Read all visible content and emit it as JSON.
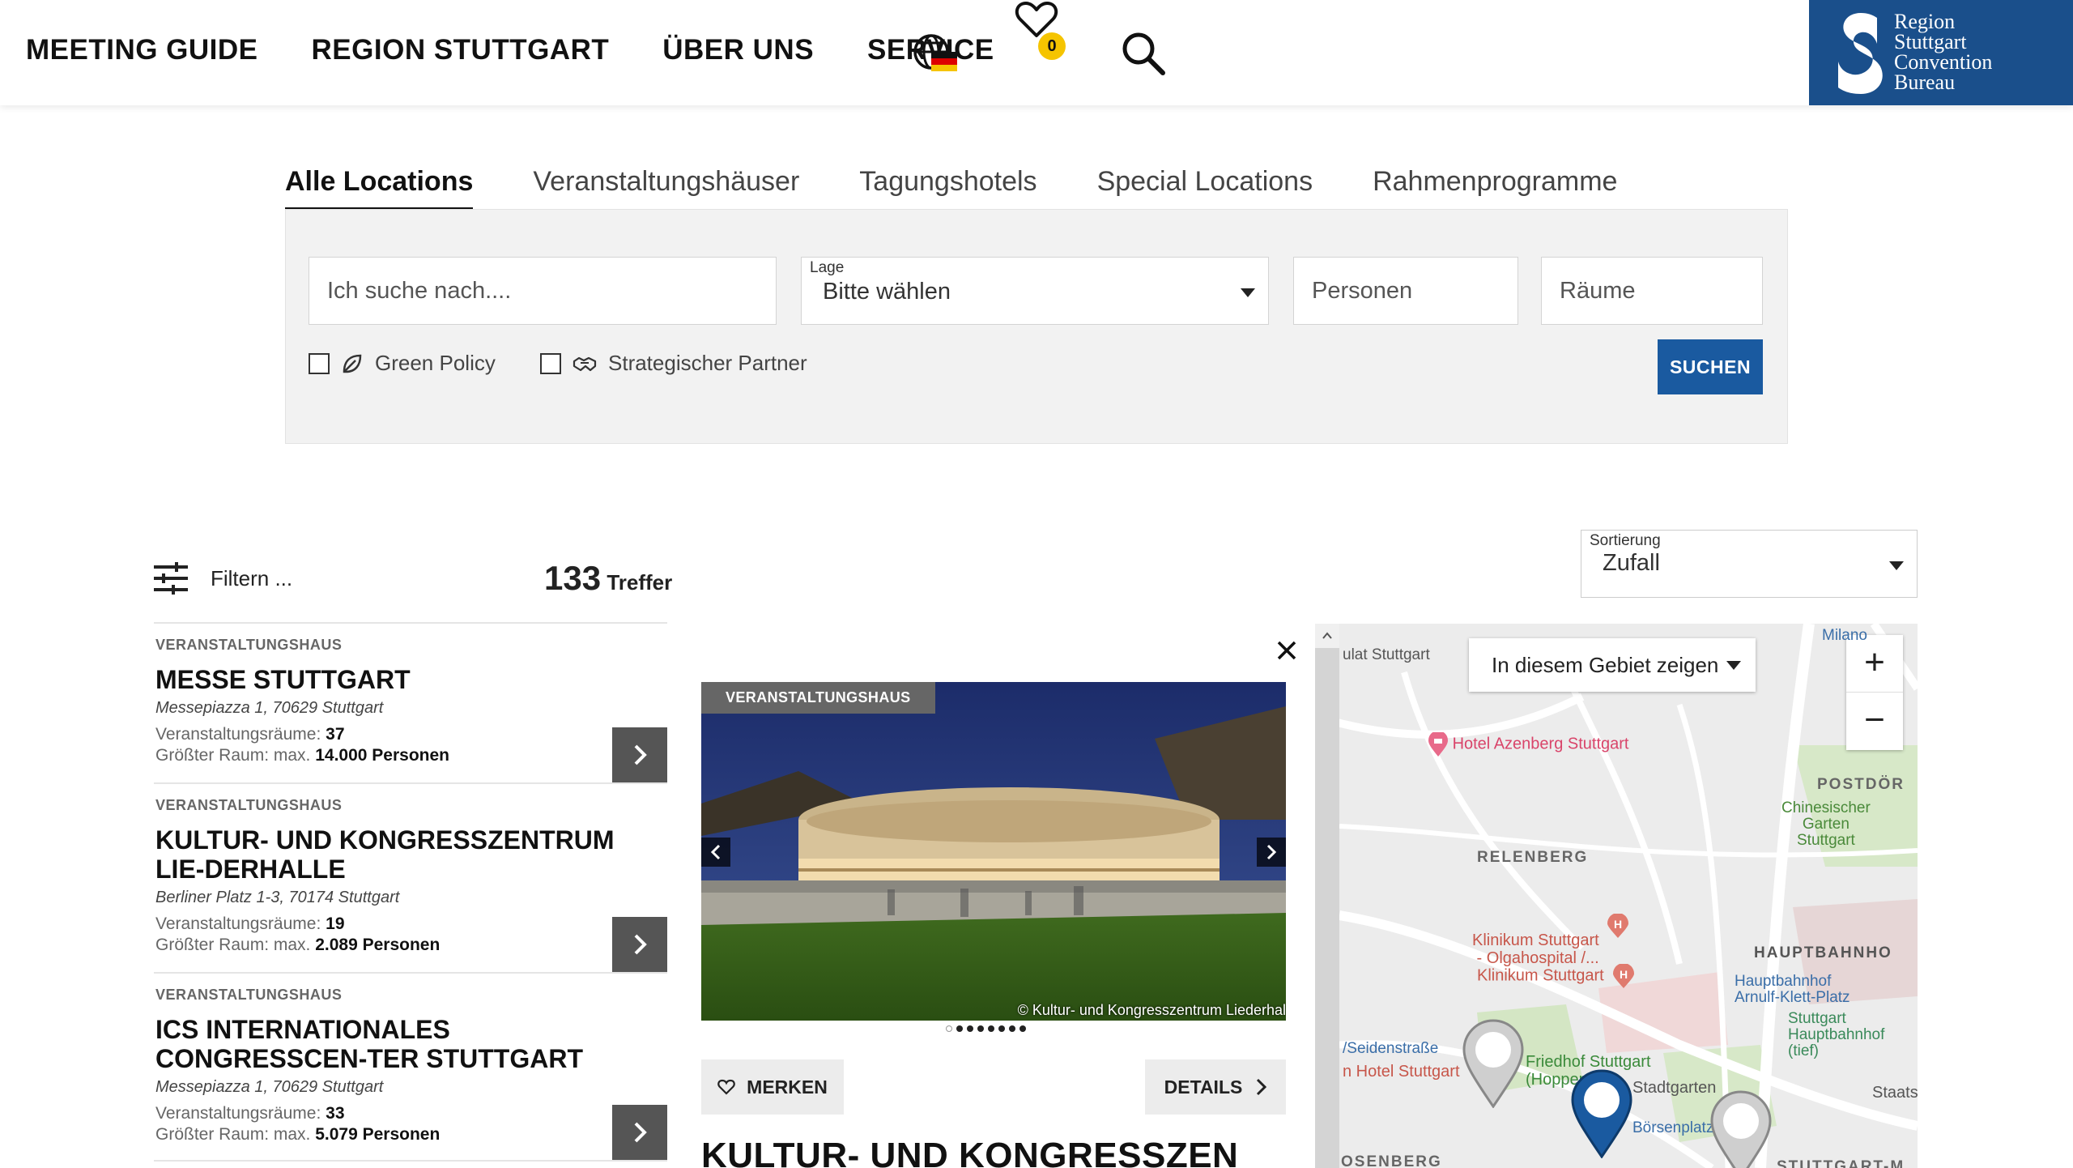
{
  "nav": {
    "items": [
      "MEETING GUIDE",
      "REGION STUTTGART",
      "ÜBER UNS",
      "SERVICE"
    ],
    "favorites_count": "0"
  },
  "logo": {
    "text": "Region\nStuttgart\nConvention\nBureau"
  },
  "tabs": [
    "Alle Locations",
    "Veranstaltungshäuser",
    "Tagungshotels",
    "Special Locations",
    "Rahmenprogramme"
  ],
  "search": {
    "query_placeholder": "Ich suche nach....",
    "lage_label": "Lage",
    "lage_value": "Bitte wählen",
    "personen_placeholder": "Personen",
    "raeume_placeholder": "Räume",
    "green_policy_label": "Green Policy",
    "partner_label": "Strategischer Partner",
    "submit_label": "SUCHEN"
  },
  "results": {
    "filter_label": "Filtern ...",
    "count": "133",
    "count_suffix": "Treffer",
    "sort_label": "Sortierung",
    "sort_value": "Zufall"
  },
  "list": [
    {
      "category": "VERANSTALTUNGSHAUS",
      "title": "MESSE STUTTGART",
      "address": "Messepiazza 1, 70629 Stuttgart",
      "rooms_label": "Veranstaltungsräume:",
      "rooms": "37",
      "largest_label": "Größter Raum: max.",
      "largest": "14.000 Personen"
    },
    {
      "category": "VERANSTALTUNGSHAUS",
      "title": "KULTUR- UND KONGRESSZENTRUM LIE-DERHALLE",
      "address": "Berliner Platz 1-3, 70174 Stuttgart",
      "rooms_label": "Veranstaltungsräume:",
      "rooms": "19",
      "largest_label": "Größter Raum: max.",
      "largest": "2.089 Personen"
    },
    {
      "category": "VERANSTALTUNGSHAUS",
      "title": "ICS INTERNATIONALES CONGRESSCEN-TER STUTTGART",
      "address": "Messepiazza 1, 70629 Stuttgart",
      "rooms_label": "Veranstaltungsräume:",
      "rooms": "33",
      "largest_label": "Größter Raum: max.",
      "largest": "5.079 Personen"
    }
  ],
  "detail": {
    "tag": "VERANSTALTUNGSHAUS",
    "copyright": "© Kultur- und Kongresszentrum Liederhal",
    "merken_label": "MERKEN",
    "details_label": "DETAILS",
    "title": "KULTUR- UND KONGRESSZEN"
  },
  "map": {
    "area_button": "In diesem Gebiet zeigen",
    "labels": {
      "stuttgart": "ulat Stuttgart",
      "azenberg": "Hotel Azenberg Stuttgart",
      "chinese_garden": "Chinesischer\nGarten\nStuttgart",
      "relenberg": "RELENBERG",
      "postdorf": "POSTDÖR",
      "olgahospital": "Klinikum Stuttgart\n- Olgahospital /...",
      "klinikum": "Klinikum Stuttgart",
      "hauptbahnhof": "HAUPTBAHNHO",
      "hauptbahnhof_stop": "Hauptbahnhof\nArnulf-Klett-Platz",
      "hbf_tief": "Stuttgart\nHauptbahnhof (tief)",
      "friedhof": "Friedhof Stuttgart\n(Hoppenlau)",
      "seidenstrasse": "/Seidenstraße",
      "hotel_stuttgart": "n Hotel Stuttgart",
      "stadtgarten": "Stadtgarten",
      "boersenplatz": "Börsenplatz",
      "staats": "Staats",
      "milano": "Milano",
      "rosenberg": "OSENBERG",
      "stuttgart_m": "STUTTGART-M"
    }
  },
  "colors": {
    "brand_blue": "#1a4f8b",
    "button_blue": "#1a5aa0",
    "badge_yellow": "#f5c400"
  }
}
